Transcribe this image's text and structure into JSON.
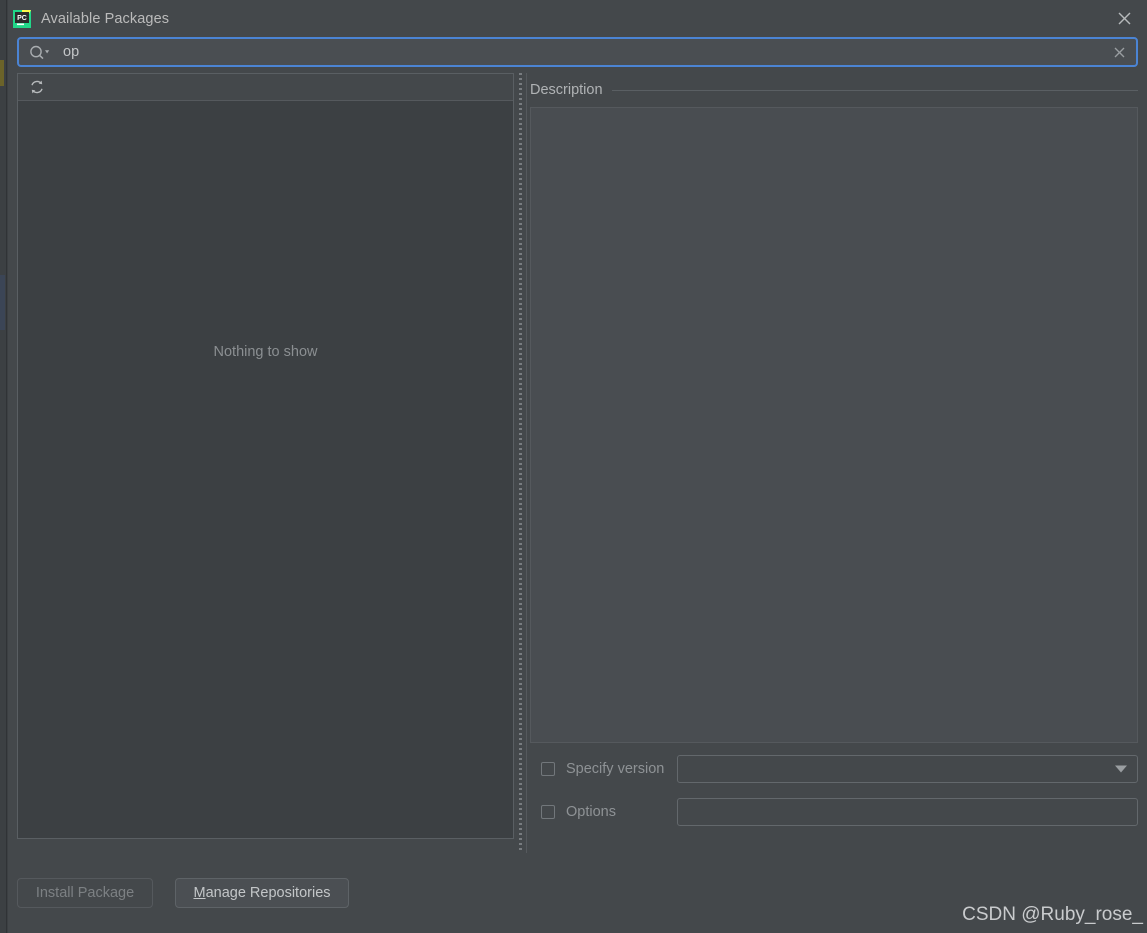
{
  "window": {
    "title": "Available Packages",
    "app_icon": "pycharm-logo-icon",
    "close_icon": "close-icon"
  },
  "search": {
    "icon": "search-icon",
    "value": "op",
    "clear_icon": "clear-icon",
    "focused": true
  },
  "package_list": {
    "refresh_icon": "refresh-icon",
    "empty_text": "Nothing to show",
    "items": []
  },
  "splitter": {
    "name": "vertical-splitter"
  },
  "description": {
    "title": "Description",
    "body": ""
  },
  "install_options": {
    "specify_version": {
      "label": "Specify version",
      "checked": false,
      "value": "",
      "dropdown_icon": "chevron-down-icon"
    },
    "options": {
      "label": "Options",
      "checked": false,
      "value": ""
    }
  },
  "footer": {
    "install_button": {
      "label": "Install Package",
      "enabled": false
    },
    "manage_repositories_button": {
      "mnemonic": "M",
      "label_rest": "anage Repositories",
      "enabled": true
    }
  },
  "watermark": {
    "text": "CSDN @Ruby_rose_"
  },
  "colors": {
    "dialog_background": "#44484b",
    "list_background": "#3c4043",
    "description_background": "#494d51",
    "focus_border": "#4b84d4",
    "text_primary": "#bbbbbb",
    "text_disabled": "#7c8083"
  }
}
